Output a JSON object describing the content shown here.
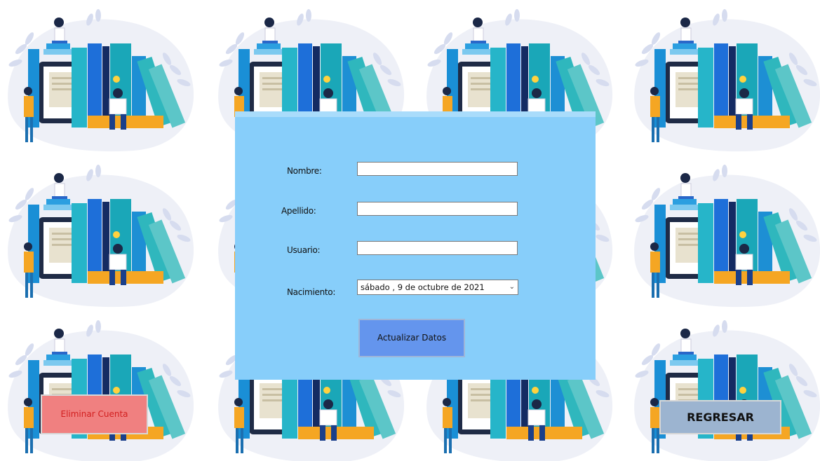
{
  "form": {
    "nombre_label": "Nombre:",
    "nombre_value": "",
    "apellido_label": "Apellido:",
    "apellido_value": "",
    "usuario_label": "Usuario:",
    "usuario_value": "",
    "nacimiento_label": "Nacimiento:",
    "nacimiento_value": "sábado ,  9 de   octubre   de 2021",
    "update_button": "Actualizar Datos"
  },
  "actions": {
    "delete_button": "Eliminar Cuenta",
    "back_button": "REGRESAR"
  },
  "colors": {
    "panel": "#87cefa",
    "update_button": "#6495ed",
    "delete_button": "#f08080",
    "delete_text": "#d21f1f",
    "back_button": "#9cb4d0"
  },
  "background": {
    "illustration_icon": "people-reading-books-illustration"
  }
}
